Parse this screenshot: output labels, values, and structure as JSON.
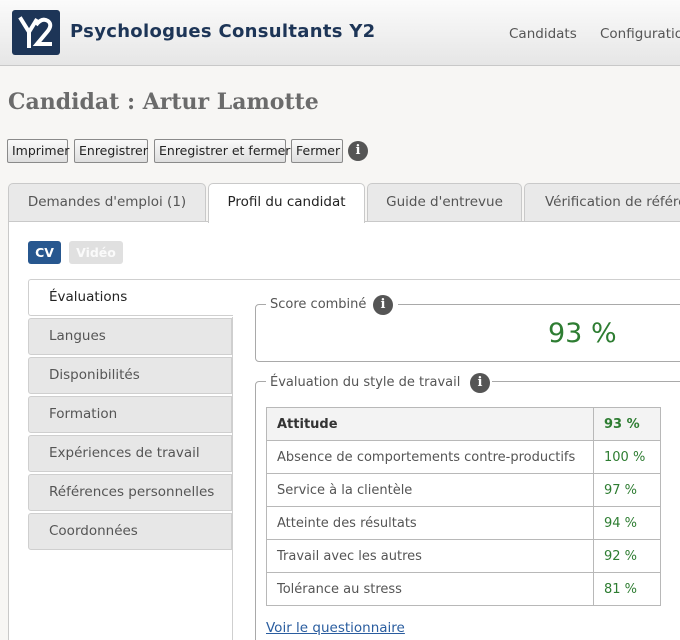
{
  "header": {
    "logo_text": "Y2",
    "brand": "Psychologues Consultants Y2",
    "nav": [
      "Candidats",
      "Configuration"
    ]
  },
  "page": {
    "title": "Candidat : Artur Lamotte"
  },
  "toolbar": {
    "print_label": "Imprimer",
    "save_label": "Enregistrer",
    "save_close_label": "Enregistrer et fermer",
    "close_label": "Fermer",
    "info_glyph": "i"
  },
  "tabs": [
    {
      "label": "Demandes d'emploi (1)",
      "active": false
    },
    {
      "label": "Profil du candidat",
      "active": true
    },
    {
      "label": "Guide d'entrevue",
      "active": false
    },
    {
      "label": "Vérification de références",
      "active": false
    }
  ],
  "doc_toggle": {
    "cv": "CV",
    "video": "Vidéo"
  },
  "sidebar": {
    "items": [
      {
        "label": "Évaluations",
        "active": true
      },
      {
        "label": "Langues"
      },
      {
        "label": "Disponibilités"
      },
      {
        "label": "Formation"
      },
      {
        "label": "Expériences de travail"
      },
      {
        "label": "Références personnelles"
      },
      {
        "label": "Coordonnées"
      }
    ]
  },
  "score": {
    "legend": "Score combiné",
    "value": "93 %"
  },
  "work_style": {
    "legend": "Évaluation du style de travail",
    "rows": [
      {
        "name": "Attitude",
        "value": "93 %"
      },
      {
        "name": "Absence de comportements contre-productifs",
        "value": "100 %"
      },
      {
        "name": "Service à la clientèle",
        "value": "97 %"
      },
      {
        "name": "Atteinte des résultats",
        "value": "94 %"
      },
      {
        "name": "Travail avec les autres",
        "value": "92 %"
      },
      {
        "name": "Tolérance au stress",
        "value": "81 %"
      }
    ],
    "link": "Voir le questionnaire"
  },
  "colors": {
    "brand": "#1d3557",
    "accent": "#27578f",
    "success": "#2e7d32",
    "link": "#2a5d9f"
  }
}
